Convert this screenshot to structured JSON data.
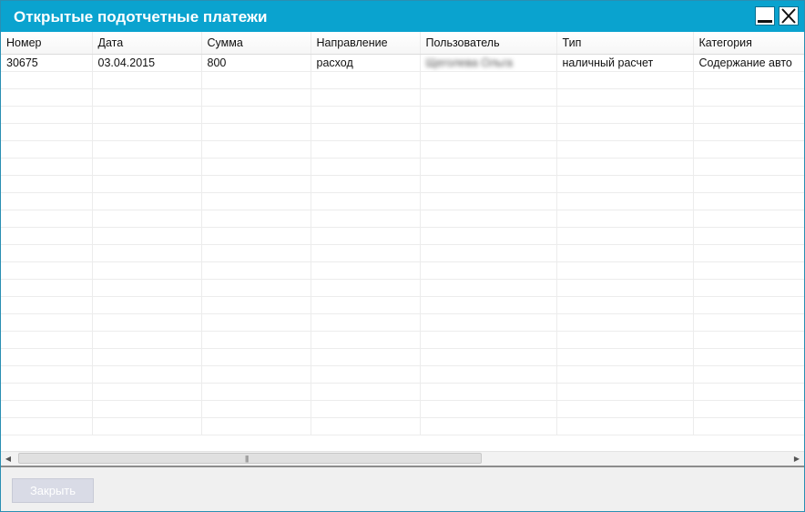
{
  "window": {
    "title": "Открытые подотчетные платежи"
  },
  "grid": {
    "columns": [
      "Номер",
      "Дата",
      "Сумма",
      "Направление",
      "Пользователь",
      "Тип",
      "Категория"
    ],
    "rows": [
      [
        "30675",
        "03.04.2015",
        "800",
        "расход",
        "Щеголева Ольга",
        "наличный расчет",
        "Содержание авто"
      ]
    ],
    "empty_row_count": 21
  },
  "scrollbar": {
    "left_arrow": "◀",
    "right_arrow": "▶",
    "grip": "|||"
  },
  "footer": {
    "close_label": "Закрыть"
  },
  "colors": {
    "titlebar": "#0aa3cf",
    "close_button_disabled": "#d9dbe6"
  },
  "icons": {
    "minimize": "minimize-icon",
    "close": "close-icon"
  }
}
